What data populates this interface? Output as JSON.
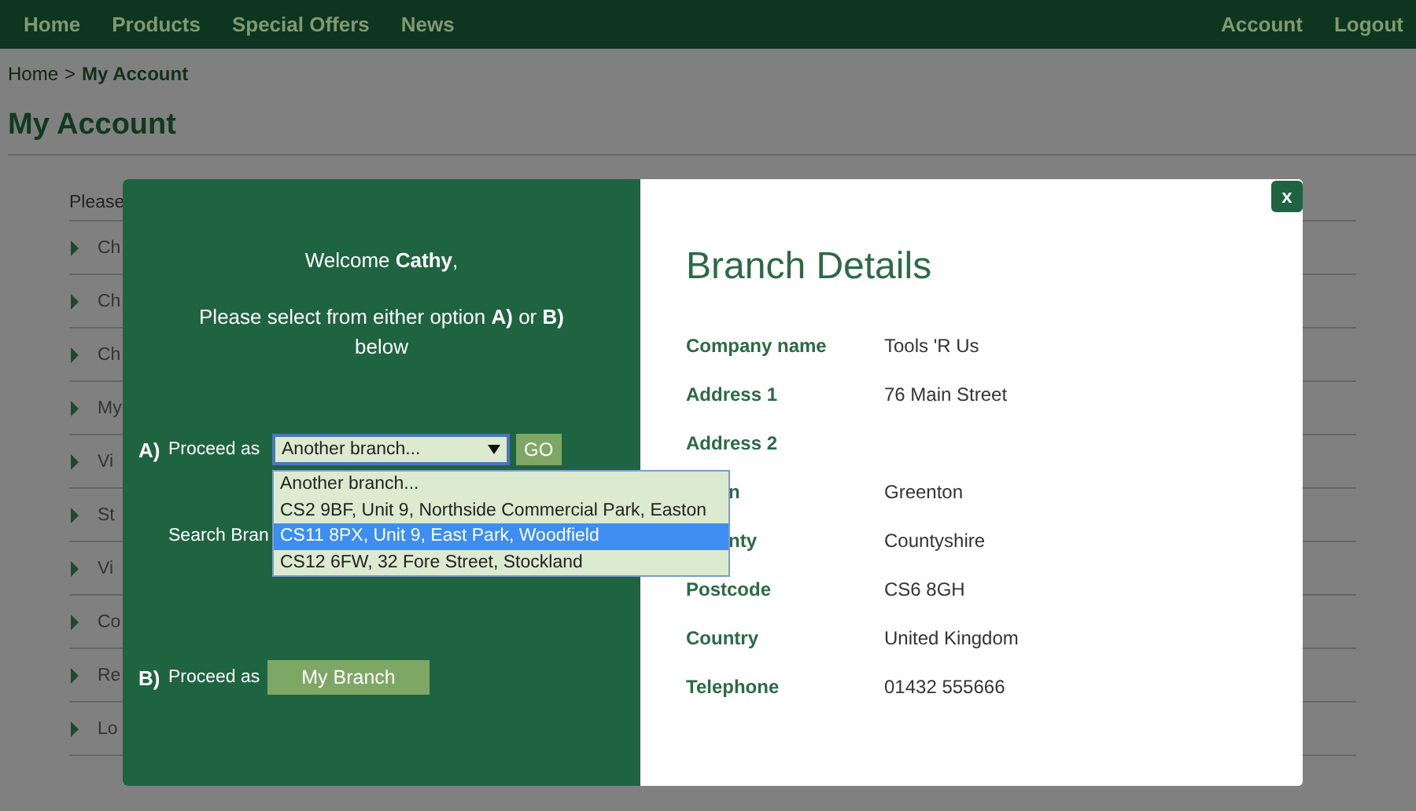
{
  "nav": {
    "left": [
      "Home",
      "Products",
      "Special Offers",
      "News"
    ],
    "right": [
      "Account",
      "Logout"
    ]
  },
  "breadcrumb": {
    "home": "Home",
    "separator": ">",
    "current": "My Account"
  },
  "page_title": "My Account",
  "account_list": {
    "intro": "Please",
    "items": [
      "Ch",
      "Ch",
      "Ch",
      "My",
      "Vi",
      "St",
      "Vi",
      "Co",
      "Re",
      "Lo"
    ]
  },
  "modal": {
    "close": "x",
    "welcome": "Welcome **Cathy**,",
    "instruction": "Please select from either option **A)** or **B)** below",
    "option_a": {
      "marker": "A)",
      "label": "Proceed as",
      "select_value": "Another branch...",
      "go": "GO",
      "options": [
        {
          "label": "Another branch...",
          "selected": false
        },
        {
          "label": "CS2 9BF, Unit 9, Northside Commercial Park, Easton",
          "selected": false
        },
        {
          "label": "CS11 8PX, Unit 9, East Park, Woodfield",
          "selected": true
        },
        {
          "label": "CS12 6FW, 32 Fore Street, Stockland",
          "selected": false
        }
      ]
    },
    "search_label": "Search Bran",
    "option_b": {
      "marker": "B)",
      "label": "Proceed as",
      "button": "My Branch"
    },
    "details": {
      "title": "Branch Details",
      "rows": [
        {
          "kind": "full",
          "label": "Company name",
          "value": "Tools 'R Us"
        },
        {
          "kind": "full",
          "label": "Address 1",
          "value": "76 Main Street"
        },
        {
          "kind": "full",
          "label": "Address 2"
        },
        {
          "kind": "covered",
          "label": "n",
          "value": "Greenton"
        },
        {
          "kind": "covered",
          "label": "nty",
          "value": "Countyshire"
        },
        {
          "kind": "full",
          "label": "Postcode",
          "value": "CS6 8GH"
        },
        {
          "kind": "full",
          "label": "Country",
          "value": "United Kingdom"
        },
        {
          "kind": "full",
          "label": "Telephone",
          "value": "01432 555666"
        }
      ]
    }
  }
}
